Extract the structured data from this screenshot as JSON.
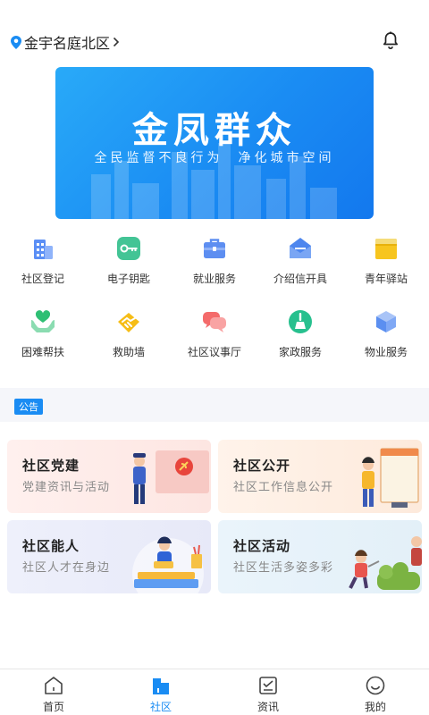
{
  "header": {
    "location": "金宇名庭北区",
    "location_icon": "location-pin-icon",
    "chevron_icon": "chevron-right-icon",
    "bell_icon": "bell-icon"
  },
  "banner": {
    "title": "金凤群众",
    "subtitle": "全民监督不良行为  净化城市空间"
  },
  "services": [
    {
      "label": "社区登记",
      "icon": "building-icon"
    },
    {
      "label": "电子钥匙",
      "icon": "key-icon"
    },
    {
      "label": "就业服务",
      "icon": "briefcase-icon"
    },
    {
      "label": "介绍信开具",
      "icon": "letter-icon"
    },
    {
      "label": "青年驿站",
      "icon": "youth-station-icon"
    },
    {
      "label": "困难帮扶",
      "icon": "heart-hands-icon"
    },
    {
      "label": "救助墙",
      "icon": "handshake-icon"
    },
    {
      "label": "社区议事厅",
      "icon": "chat-bubbles-icon"
    },
    {
      "label": "家政服务",
      "icon": "broom-icon"
    },
    {
      "label": "物业服务",
      "icon": "cube-icon"
    }
  ],
  "notice": {
    "tag": "公告"
  },
  "cards": [
    {
      "title": "社区党建",
      "subtitle": "党建资讯与活动"
    },
    {
      "title": "社区公开",
      "subtitle": "社区工作信息公开"
    },
    {
      "title": "社区能人",
      "subtitle": "社区人才在身边"
    },
    {
      "title": "社区活动",
      "subtitle": "社区生活多姿多彩"
    }
  ],
  "tabs": [
    {
      "label": "首页",
      "icon": "home-icon",
      "active": false
    },
    {
      "label": "社区",
      "icon": "community-icon",
      "active": true
    },
    {
      "label": "资讯",
      "icon": "news-icon",
      "active": false
    },
    {
      "label": "我的",
      "icon": "smile-icon",
      "active": false
    }
  ],
  "colors": {
    "accent": "#1a8cf3",
    "banner": "#1a8cf3"
  }
}
